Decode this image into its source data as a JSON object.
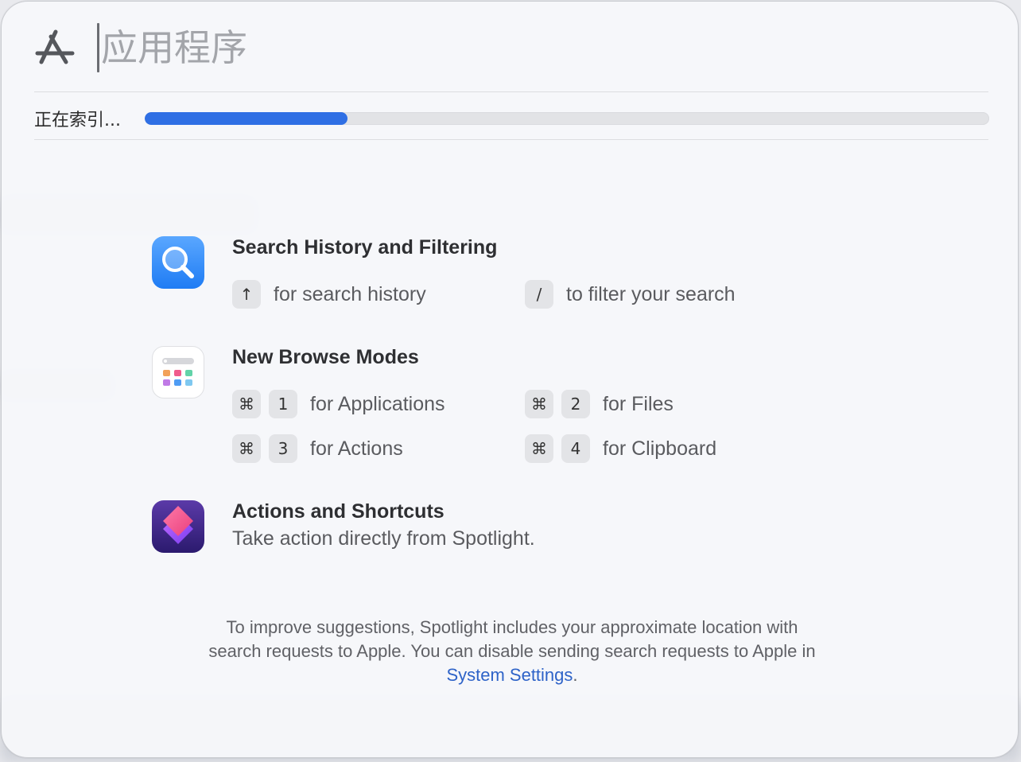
{
  "search": {
    "placeholder": "应用程序",
    "mode_icon": "app-store-icon"
  },
  "indexing": {
    "label": "正在索引...",
    "progress": 0.24,
    "color": "#2f6fe4"
  },
  "features": [
    {
      "title": "Search History and Filtering",
      "icon": "magnifier-icon",
      "hints": [
        {
          "keys": [
            "↑"
          ],
          "text": "for search history"
        },
        {
          "keys": [
            "/"
          ],
          "text": "to filter your search"
        }
      ]
    },
    {
      "title": "New Browse Modes",
      "icon": "browse-modes-icon",
      "hints": [
        {
          "keys": [
            "⌘",
            "1"
          ],
          "text": "for Applications"
        },
        {
          "keys": [
            "⌘",
            "2"
          ],
          "text": "for Files"
        },
        {
          "keys": [
            "⌘",
            "3"
          ],
          "text": "for Actions"
        },
        {
          "keys": [
            "⌘",
            "4"
          ],
          "text": "for Clipboard"
        }
      ]
    },
    {
      "title": "Actions and Shortcuts",
      "icon": "shortcuts-icon",
      "description": "Take action directly from Spotlight."
    }
  ],
  "privacy": {
    "line1": "To improve suggestions, Spotlight includes your approximate location with",
    "line2": "search requests to Apple. You can disable sending search requests to Apple in",
    "link": "System Settings",
    "suffix": "."
  }
}
